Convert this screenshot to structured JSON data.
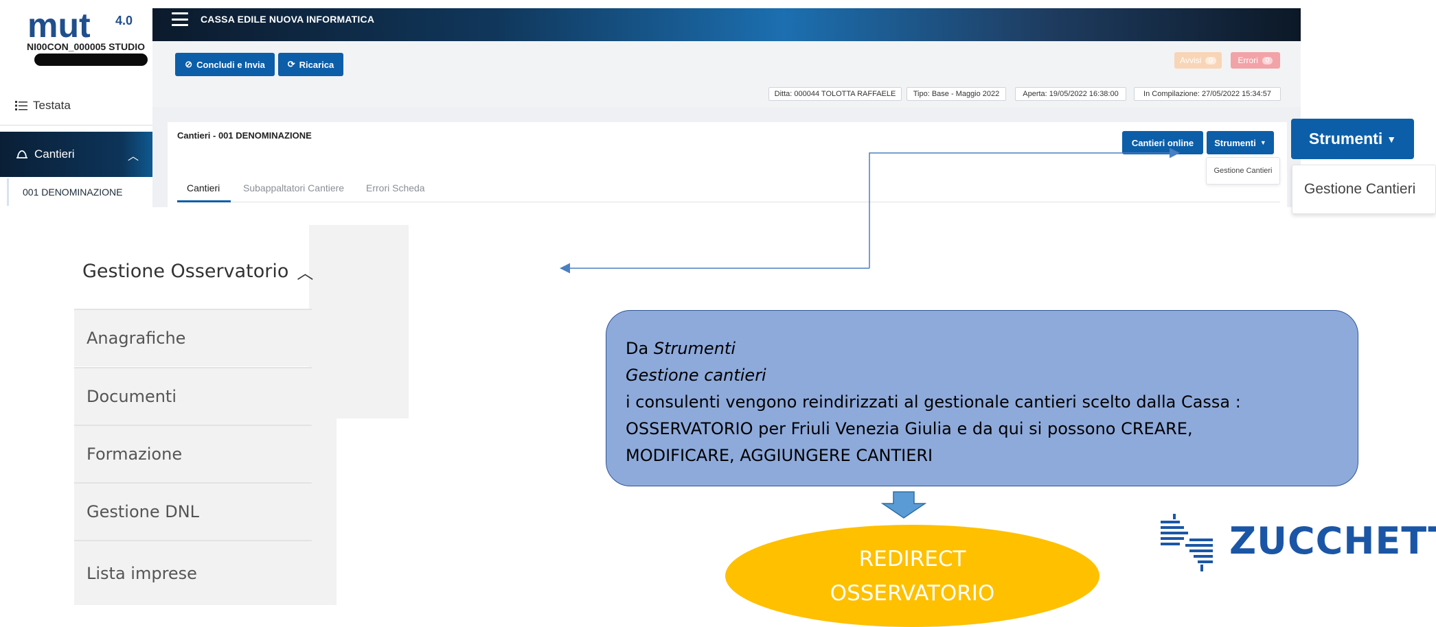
{
  "brand": {
    "logo_text": "mut",
    "logo_version": "4.0",
    "studio_code": "NI00CON_000005 STUDIO"
  },
  "sidebar": {
    "items": [
      {
        "label": "Testata"
      },
      {
        "label": "Cantieri"
      }
    ],
    "sub_item": "001 DENOMINAZIONE"
  },
  "header": {
    "title": "CASSA EDILE NUOVA INFORMATICA"
  },
  "toolbar": {
    "concludi_label": "Concludi e Invia",
    "ricarica_label": "Ricarica",
    "avvisi_label": "Avvisi",
    "avvisi_count": "0",
    "errori_label": "Errori",
    "errori_count": "0"
  },
  "info": {
    "ditta": "Ditta: 000044 TOLOTTA RAFFAELE",
    "tipo": "Tipo: Base - Maggio 2022",
    "aperta": "Aperta: 19/05/2022 16:38:00",
    "compilazione": "In Compilazione: 27/05/2022 15:34:57"
  },
  "card": {
    "title": "Cantieri - 001 DENOMINAZIONE",
    "cantieri_online_label": "Cantieri online",
    "strumenti_label": "Strumenti",
    "dropdown_item": "Gestione Cantieri",
    "tabs": [
      {
        "label": "Cantieri"
      },
      {
        "label": "Subappaltatori Cantiere"
      },
      {
        "label": "Errori Scheda"
      }
    ]
  },
  "zoom": {
    "strumenti_label": "Strumenti",
    "dropdown_item": "Gestione Cantieri"
  },
  "osservatorio_menu": {
    "header": "Gestione Osservatorio",
    "items": [
      {
        "label": "Anagrafiche"
      },
      {
        "label": "Documenti"
      },
      {
        "label": "Formazione"
      },
      {
        "label": "Gestione DNL"
      },
      {
        "label": "Lista imprese"
      }
    ]
  },
  "note": {
    "line1_prefix": "Da ",
    "line1_italic": "Strumenti",
    "line2_italic": "Gestione cantieri",
    "line3": "i consulenti vengono reindirizzati al gestionale cantieri scelto dalla Cassa :",
    "line4": "OSSERVATORIO per Friuli Venezia Giulia e da qui si possono CREARE,",
    "line5": "MODIFICARE, AGGIUNGERE CANTIERI"
  },
  "redirect": {
    "line1": "REDIRECT",
    "line2": "OSSERVATORIO"
  },
  "zucchetti": {
    "name": "ZUCCHETTI"
  },
  "colors": {
    "primary_blue": "#0c5ea8",
    "note_fill": "#8eaadb",
    "redirect_fill": "#ffc000",
    "zucchetti_blue": "#1b56a6"
  }
}
